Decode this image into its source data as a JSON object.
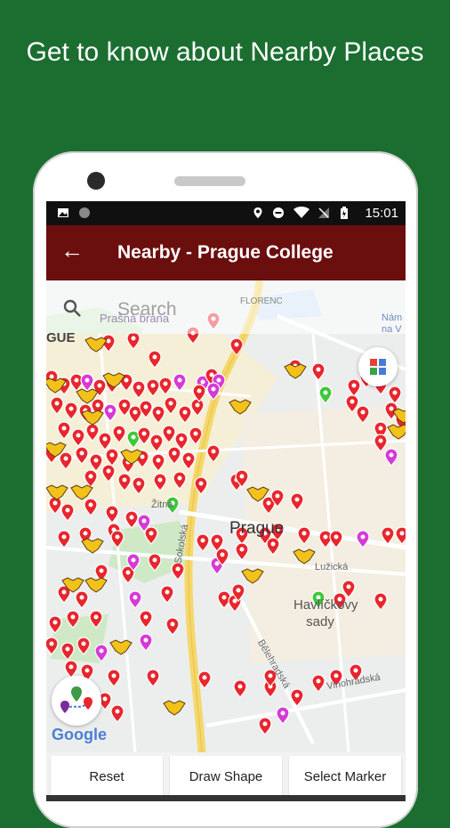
{
  "headline": "Get to know about Nearby Places",
  "status": {
    "time": "15:01"
  },
  "appbar": {
    "title": "Nearby - Prague College"
  },
  "search": {
    "placeholder": "Search"
  },
  "map_labels": {
    "florenc": "FLORENC",
    "prasna_brana": "Prašná brána",
    "gue": "GUE",
    "prague": "Prague",
    "havlickovy_sady": "Havlíčkovy sady",
    "lucicka": "Lužická",
    "zitna": "Žitná",
    "sokolska": "Sokolská",
    "belehradska": "Bělehradská",
    "vinohradska": "Vinohradská",
    "namesti": "Nám na V",
    "google": "Google"
  },
  "buttons": {
    "reset": "Reset",
    "draw_shape": "Draw Shape",
    "select_marker": "Select Marker"
  },
  "colors": {
    "background": "#1b6e30",
    "appbar": "#6b0e0e",
    "marker_red": "#e8262d",
    "marker_magenta": "#d63ad6",
    "marker_green": "#3ec83a",
    "marker_purple": "#8a3ad6",
    "road_yellow": "#f5d76a"
  }
}
